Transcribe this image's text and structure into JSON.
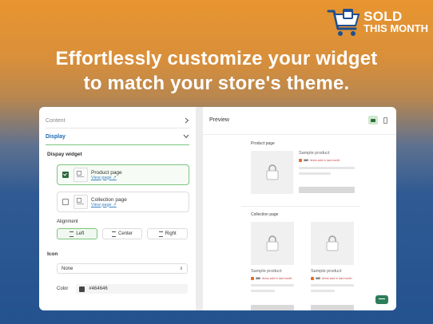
{
  "brand": {
    "line1": "SOLD",
    "line2": "THIS MONTH"
  },
  "headline": {
    "line1": "Effortlessly customize your widget",
    "line2": "to match your store's theme."
  },
  "settings": {
    "content_label": "Content",
    "display_label": "Display",
    "display_widget_label": "Dispay widget",
    "options": [
      {
        "title": "Product page",
        "link": "View page",
        "checked": true
      },
      {
        "title": "Collection page",
        "link": "View page",
        "checked": false
      }
    ],
    "alignment_label": "Alignment",
    "alignment": [
      {
        "label": "Left",
        "active": true
      },
      {
        "label": "Center",
        "active": false
      },
      {
        "label": "Right",
        "active": false
      }
    ],
    "icon_label": "Icon",
    "icon_value": "None",
    "color_label": "Color",
    "color_value": "#464646"
  },
  "preview": {
    "title": "Preview",
    "product_section": "Product page",
    "collection_section": "Collection page",
    "sample_name": "Sample product",
    "badge_count": "380",
    "badge_text": "items sold in last month"
  },
  "colors": {
    "accent_green": "#7bc67e",
    "link_blue": "#3b82c4",
    "swatch": "#464646"
  }
}
